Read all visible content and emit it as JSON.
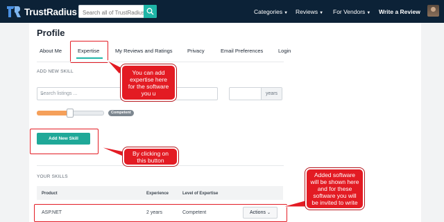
{
  "nav": {
    "brand": "TrustRadius",
    "search_placeholder": "Search all of TrustRadius",
    "links": [
      {
        "label": "Categories"
      },
      {
        "label": "Reviews"
      },
      {
        "label": "For Vendors"
      }
    ],
    "write_review": "Write a Review"
  },
  "profile": {
    "title": "Profile",
    "tabs": [
      {
        "label": "About Me"
      },
      {
        "label": "Expertise"
      },
      {
        "label": "My Reviews and Ratings"
      },
      {
        "label": "Privacy"
      },
      {
        "label": "Email Preferences"
      },
      {
        "label": "Login"
      }
    ],
    "active_tab": "Expertise"
  },
  "add_skill": {
    "section_label": "ADD NEW SKILL",
    "listing_placeholder": "Search listings ...",
    "years_value": "",
    "years_addon": "years",
    "level": "Competent",
    "level_fraction": 0.33,
    "button_label": "Add New Skill"
  },
  "your_skills": {
    "section_label": "YOUR SKILLS",
    "columns": [
      "Product",
      "Experience",
      "Level of Expertise"
    ],
    "rows": [
      {
        "product": "ASP.NET",
        "experience": "2 years",
        "level": "Competent",
        "actions": "Actions"
      }
    ]
  },
  "callouts": {
    "expertise": "You can add expertise here for the software you u",
    "add_button": "By clicking on this button",
    "table": "Added software will be shown here and for these software you will be invited to write"
  },
  "colors": {
    "nav_bg": "#0c2237",
    "accent": "#1fb5a7",
    "callout": "#e31b23",
    "slider": "#f5a05a"
  }
}
